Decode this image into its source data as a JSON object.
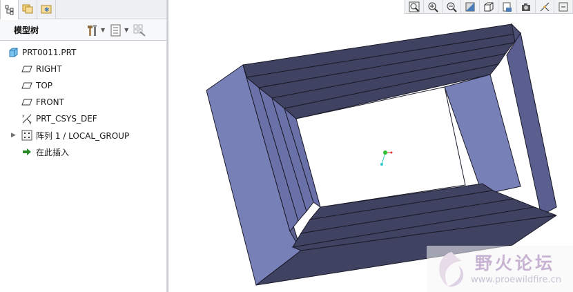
{
  "model_tree": {
    "title": "模型树",
    "items": [
      {
        "label": "PRT0011.PRT",
        "icon": "part-icon"
      },
      {
        "label": "RIGHT",
        "icon": "datum-plane-icon"
      },
      {
        "label": "TOP",
        "icon": "datum-plane-icon"
      },
      {
        "label": "FRONT",
        "icon": "datum-plane-icon"
      },
      {
        "label": "PRT_CSYS_DEF",
        "icon": "csys-icon"
      },
      {
        "label": "阵列 1 / LOCAL_GROUP",
        "icon": "pattern-icon",
        "expandable": true
      },
      {
        "label": "在此插入",
        "icon": "insert-arrow-icon"
      }
    ]
  },
  "nav_tabs": [
    "model-tree-tab",
    "layer-tree-tab",
    "favorites-tab"
  ],
  "view_toolbar": [
    "zoom-fit-icon",
    "zoom-in-icon",
    "zoom-out-icon",
    "shading-icon",
    "saved-views-icon",
    "layers-icon",
    "render-icon",
    "datum-display-icon",
    "more-icon"
  ],
  "watermark": {
    "title": "野火论坛",
    "url": "www.proewildfire.cn"
  },
  "colors": {
    "model_face_light": "#7880b8",
    "model_face_dark": "#3f4260",
    "model_edge": "#1a1a2a",
    "insert_arrow": "#2a8a2a",
    "part_icon": "#4aa3d8"
  }
}
